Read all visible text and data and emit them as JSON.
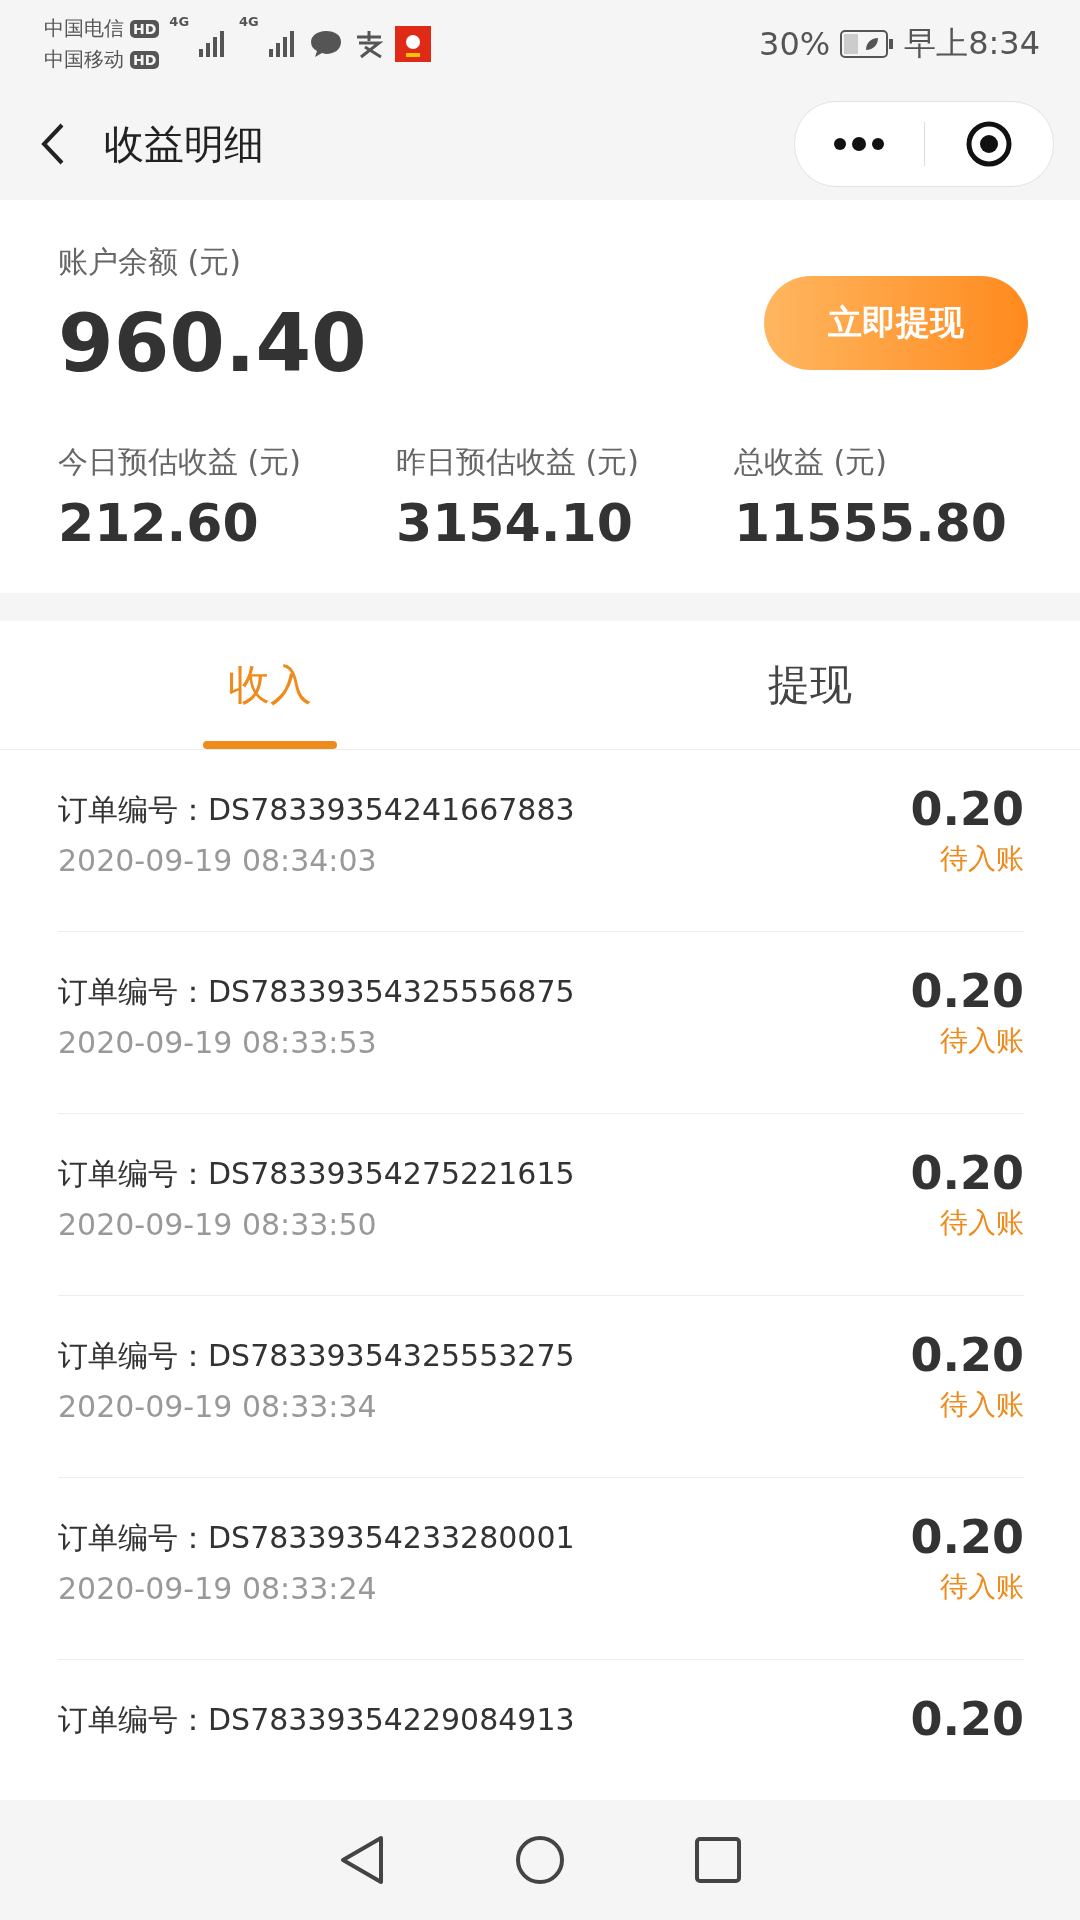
{
  "status_bar": {
    "carriers": [
      {
        "name": "中国电信",
        "badge": "HD"
      },
      {
        "name": "中国移动",
        "badge": "HD"
      }
    ],
    "network_labels": [
      "4G",
      "4G"
    ],
    "battery": "30%",
    "time": "早上8:34"
  },
  "nav": {
    "title": "收益明细"
  },
  "balance": {
    "label": "账户余额 (元)",
    "amount": "960.40",
    "button": "立即提现"
  },
  "stats": [
    {
      "label": "今日预估收益 (元)",
      "value": "212.60"
    },
    {
      "label": "昨日预估收益 (元)",
      "value": "3154.10"
    },
    {
      "label": "总收益 (元)",
      "value": "11555.80"
    }
  ],
  "tabs": [
    {
      "label": "收入",
      "selected": true
    },
    {
      "label": "提现",
      "selected": false
    }
  ],
  "records": [
    {
      "order": "订单编号：DS78339354241667883",
      "time": "2020-09-19 08:34:03",
      "amount": "0.20",
      "status": "待入账"
    },
    {
      "order": "订单编号：DS78339354325556875",
      "time": "2020-09-19 08:33:53",
      "amount": "0.20",
      "status": "待入账"
    },
    {
      "order": "订单编号：DS78339354275221615",
      "time": "2020-09-19 08:33:50",
      "amount": "0.20",
      "status": "待入账"
    },
    {
      "order": "订单编号：DS78339354325553275",
      "time": "2020-09-19 08:33:34",
      "amount": "0.20",
      "status": "待入账"
    },
    {
      "order": "订单编号：DS78339354233280001",
      "time": "2020-09-19 08:33:24",
      "amount": "0.20",
      "status": "待入账"
    },
    {
      "order": "订单编号：DS78339354229084913",
      "amount": "0.20"
    }
  ]
}
